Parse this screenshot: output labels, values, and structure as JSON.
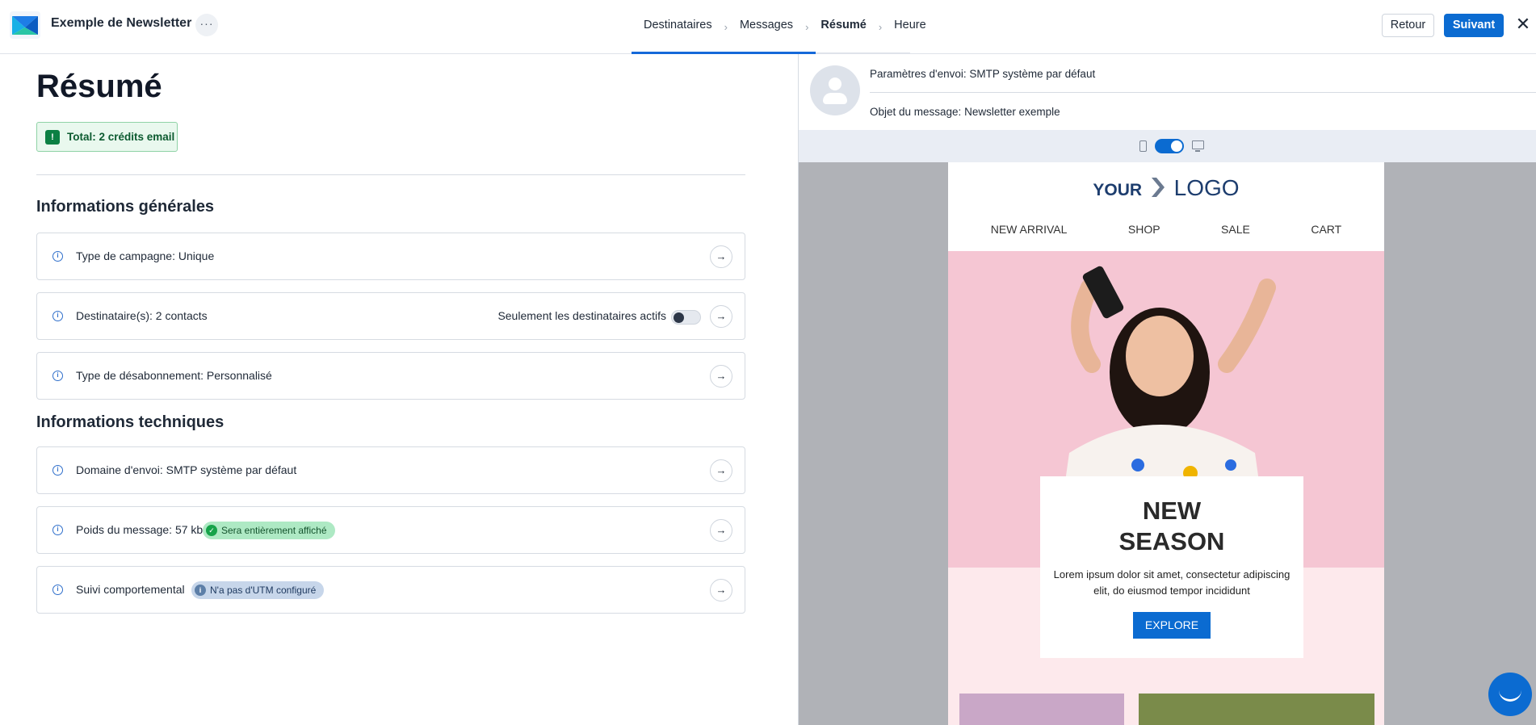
{
  "header": {
    "app_title": "Exemple de Newsletter",
    "more_label": "···",
    "steps": [
      {
        "label": "Destinataires"
      },
      {
        "label": "Messages"
      },
      {
        "label": "Résumé"
      },
      {
        "label": "Heure"
      }
    ],
    "active_step": "Résumé",
    "progress_fraction": 0.66,
    "back_label": "Retour",
    "next_label": "Suivant",
    "close_label": "✕"
  },
  "summary": {
    "title": "Résumé",
    "credits_label": "Total: 2 crédits email",
    "general_title": "Informations générales",
    "technical_title": "Informations techniques",
    "rows": {
      "campaign_type": "Type de campagne: Unique",
      "recipients": "Destinataire(s): 2 contacts",
      "active_only_label": "Seulement les destinataires actifs",
      "active_only_enabled": false,
      "unsubscribe_type": "Type de désabonnement: Personnalisé",
      "sending_domain": "Domaine d'envoi: SMTP système par défaut",
      "message_weight": "Poids du message: 57 kb",
      "weight_badge": "Sera entièrement affiché",
      "tracking": "Suivi comportemental",
      "tracking_badge": "N'a pas d'UTM configuré"
    }
  },
  "preview": {
    "send_settings": "Paramètres d'envoi: SMTP système par défaut",
    "subject": "Objet du message: Newsletter exemple",
    "view_mode": "desktop",
    "email": {
      "logo_your": "YOUR",
      "logo_logo": "LOGO",
      "nav": [
        "NEW ARRIVAL",
        "SHOP",
        "SALE",
        "CART"
      ],
      "hero_title_1": "NEW",
      "hero_title_2": "SEASON",
      "hero_text": "Lorem ipsum dolor sit amet, consectetur adipiscing elit, do eiusmod tempor incididunt",
      "hero_button": "EXPLORE"
    }
  },
  "colors": {
    "accent": "#0b6bd1",
    "success_bg": "#e9f8ee",
    "success": "#0b8043",
    "hero_pink": "#f5c6d3"
  }
}
